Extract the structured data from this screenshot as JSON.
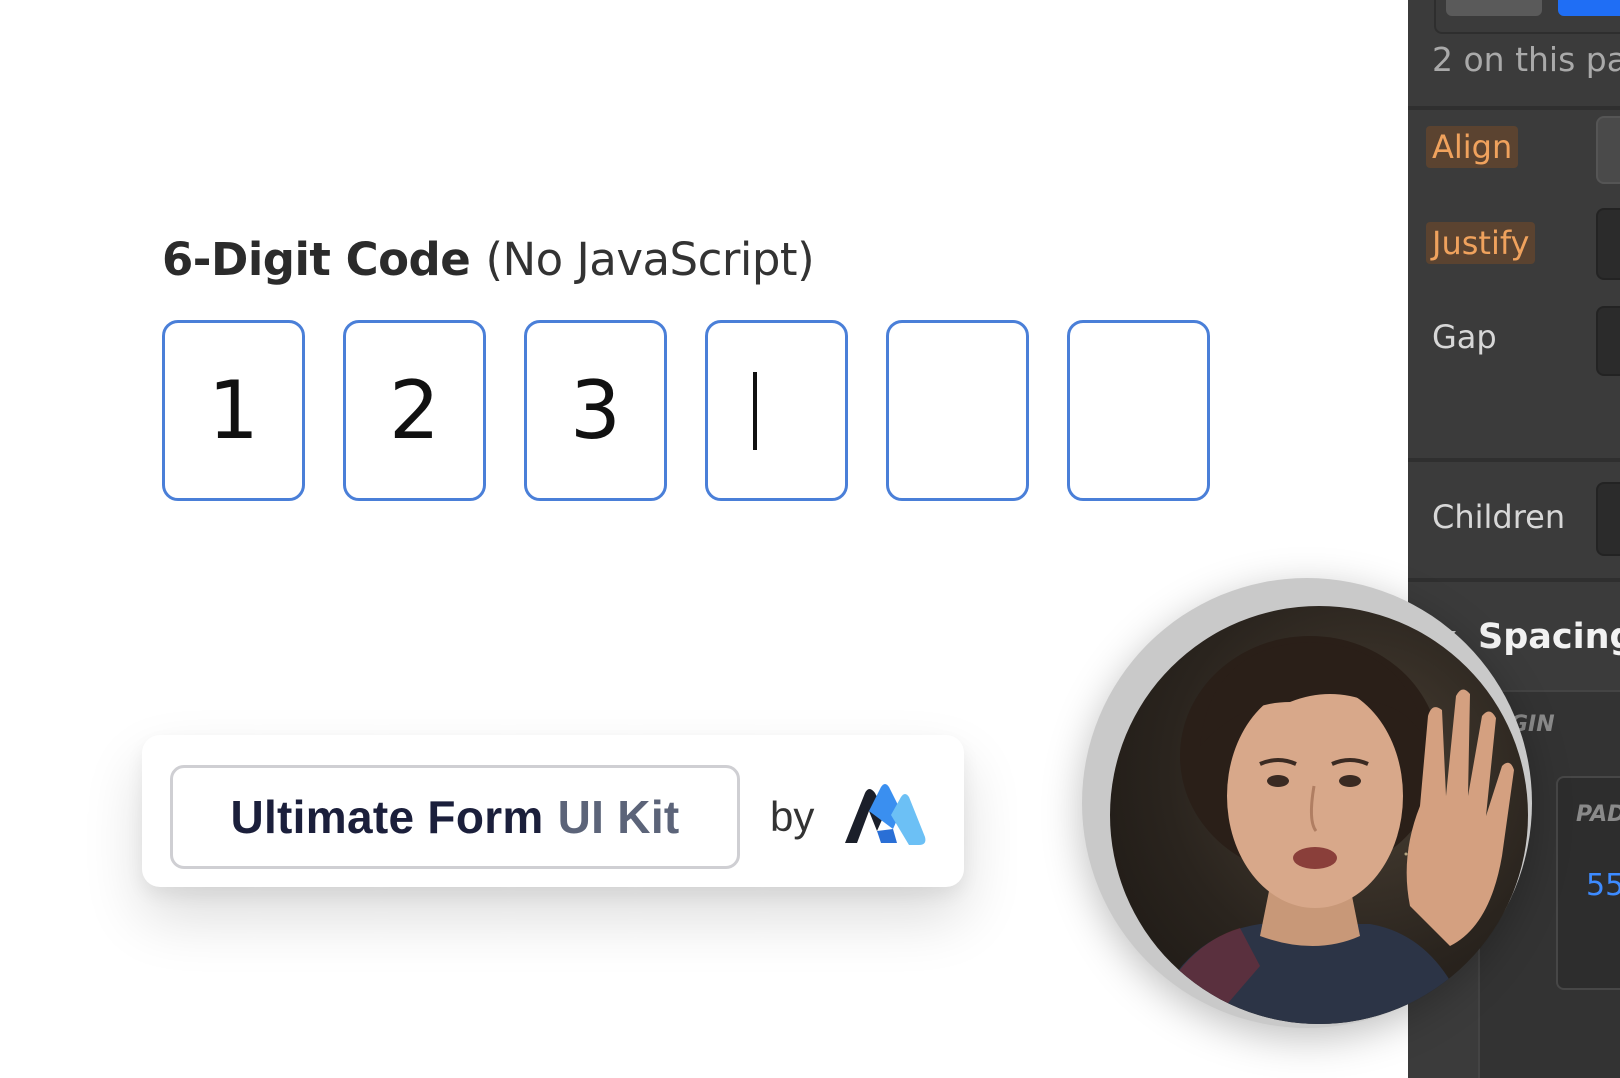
{
  "code_widget": {
    "title_bold": "6-Digit Code",
    "title_light": "(No JavaScript)",
    "digits": [
      "1",
      "2",
      "3",
      "",
      "",
      ""
    ],
    "focused_index": 3,
    "border_color": "#4a7fd8"
  },
  "brand": {
    "kit_name_main": "Ultimate Form",
    "kit_name_accent": "UI Kit",
    "by_label": "by",
    "logo_icon": "brand-m-logo-icon"
  },
  "panel": {
    "count_text": "2 on this pa",
    "align_label": "Align",
    "justify_label": "Justify",
    "gap_label": "Gap",
    "children_label": "Children",
    "spacing_label": "Spacing",
    "margin_label": "GIN",
    "padding_label": "PAD",
    "padding_value": "55",
    "accent_color": "#1f6ef5",
    "highlight_color": "#f0a25d"
  },
  "webcam": {
    "icon": "presenter-webcam"
  }
}
